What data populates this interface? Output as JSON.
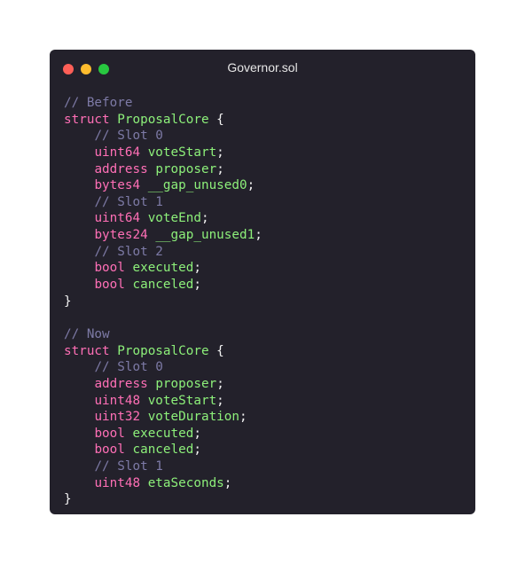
{
  "window": {
    "title": "Governor.sol",
    "controls": [
      {
        "name": "close-dot",
        "color": "#fe5f57"
      },
      {
        "name": "minimize-dot",
        "color": "#febc2e"
      },
      {
        "name": "maximize-dot",
        "color": "#28c840"
      }
    ]
  },
  "colors": {
    "background": "#23212b",
    "comment": "#7d7aa6",
    "keyword": "#ff6fb6",
    "identifier": "#8df07a",
    "punctuation": "#f2f2f2"
  },
  "code": [
    [
      {
        "t": "// Before",
        "k": "comment"
      }
    ],
    [
      {
        "t": "struct",
        "k": "keyword"
      },
      {
        "t": " ",
        "k": "space"
      },
      {
        "t": "ProposalCore",
        "k": "name"
      },
      {
        "t": " {",
        "k": "punct"
      }
    ],
    [
      {
        "t": "    ",
        "k": "space"
      },
      {
        "t": "// Slot 0",
        "k": "comment"
      }
    ],
    [
      {
        "t": "    ",
        "k": "space"
      },
      {
        "t": "uint64",
        "k": "type"
      },
      {
        "t": " ",
        "k": "space"
      },
      {
        "t": "voteStart",
        "k": "name"
      },
      {
        "t": ";",
        "k": "punct"
      }
    ],
    [
      {
        "t": "    ",
        "k": "space"
      },
      {
        "t": "address",
        "k": "type"
      },
      {
        "t": " ",
        "k": "space"
      },
      {
        "t": "proposer",
        "k": "name"
      },
      {
        "t": ";",
        "k": "punct"
      }
    ],
    [
      {
        "t": "    ",
        "k": "space"
      },
      {
        "t": "bytes4",
        "k": "type"
      },
      {
        "t": " ",
        "k": "space"
      },
      {
        "t": "__gap_unused0",
        "k": "name"
      },
      {
        "t": ";",
        "k": "punct"
      }
    ],
    [
      {
        "t": "    ",
        "k": "space"
      },
      {
        "t": "// Slot 1",
        "k": "comment"
      }
    ],
    [
      {
        "t": "    ",
        "k": "space"
      },
      {
        "t": "uint64",
        "k": "type"
      },
      {
        "t": " ",
        "k": "space"
      },
      {
        "t": "voteEnd",
        "k": "name"
      },
      {
        "t": ";",
        "k": "punct"
      }
    ],
    [
      {
        "t": "    ",
        "k": "space"
      },
      {
        "t": "bytes24",
        "k": "type"
      },
      {
        "t": " ",
        "k": "space"
      },
      {
        "t": "__gap_unused1",
        "k": "name"
      },
      {
        "t": ";",
        "k": "punct"
      }
    ],
    [
      {
        "t": "    ",
        "k": "space"
      },
      {
        "t": "// Slot 2",
        "k": "comment"
      }
    ],
    [
      {
        "t": "    ",
        "k": "space"
      },
      {
        "t": "bool",
        "k": "type"
      },
      {
        "t": " ",
        "k": "space"
      },
      {
        "t": "executed",
        "k": "name"
      },
      {
        "t": ";",
        "k": "punct"
      }
    ],
    [
      {
        "t": "    ",
        "k": "space"
      },
      {
        "t": "bool",
        "k": "type"
      },
      {
        "t": " ",
        "k": "space"
      },
      {
        "t": "canceled",
        "k": "name"
      },
      {
        "t": ";",
        "k": "punct"
      }
    ],
    [
      {
        "t": "}",
        "k": "punct"
      }
    ],
    [],
    [
      {
        "t": "// Now",
        "k": "comment"
      }
    ],
    [
      {
        "t": "struct",
        "k": "keyword"
      },
      {
        "t": " ",
        "k": "space"
      },
      {
        "t": "ProposalCore",
        "k": "name"
      },
      {
        "t": " {",
        "k": "punct"
      }
    ],
    [
      {
        "t": "    ",
        "k": "space"
      },
      {
        "t": "// Slot 0",
        "k": "comment"
      }
    ],
    [
      {
        "t": "    ",
        "k": "space"
      },
      {
        "t": "address",
        "k": "type"
      },
      {
        "t": " ",
        "k": "space"
      },
      {
        "t": "proposer",
        "k": "name"
      },
      {
        "t": ";",
        "k": "punct"
      }
    ],
    [
      {
        "t": "    ",
        "k": "space"
      },
      {
        "t": "uint48",
        "k": "type"
      },
      {
        "t": " ",
        "k": "space"
      },
      {
        "t": "voteStart",
        "k": "name"
      },
      {
        "t": ";",
        "k": "punct"
      }
    ],
    [
      {
        "t": "    ",
        "k": "space"
      },
      {
        "t": "uint32",
        "k": "type"
      },
      {
        "t": " ",
        "k": "space"
      },
      {
        "t": "voteDuration",
        "k": "name"
      },
      {
        "t": ";",
        "k": "punct"
      }
    ],
    [
      {
        "t": "    ",
        "k": "space"
      },
      {
        "t": "bool",
        "k": "type"
      },
      {
        "t": " ",
        "k": "space"
      },
      {
        "t": "executed",
        "k": "name"
      },
      {
        "t": ";",
        "k": "punct"
      }
    ],
    [
      {
        "t": "    ",
        "k": "space"
      },
      {
        "t": "bool",
        "k": "type"
      },
      {
        "t": " ",
        "k": "space"
      },
      {
        "t": "canceled",
        "k": "name"
      },
      {
        "t": ";",
        "k": "punct"
      }
    ],
    [
      {
        "t": "    ",
        "k": "space"
      },
      {
        "t": "// Slot 1",
        "k": "comment"
      }
    ],
    [
      {
        "t": "    ",
        "k": "space"
      },
      {
        "t": "uint48",
        "k": "type"
      },
      {
        "t": " ",
        "k": "space"
      },
      {
        "t": "etaSeconds",
        "k": "name"
      },
      {
        "t": ";",
        "k": "punct"
      }
    ],
    [
      {
        "t": "}",
        "k": "punct"
      }
    ]
  ]
}
